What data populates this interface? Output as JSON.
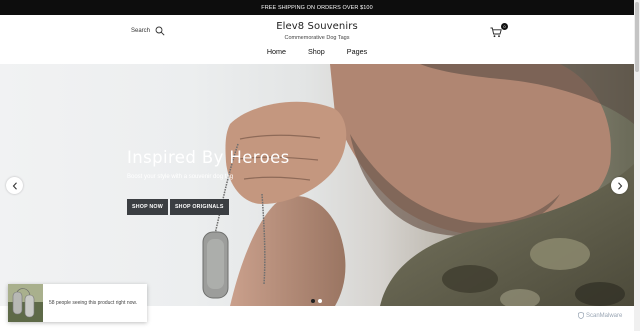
{
  "announcement": {
    "text": "FREE SHIPPING ON ORDERS OVER $100"
  },
  "header": {
    "search_label": "Search",
    "brand_name": "Elev8 Souvenirs",
    "brand_tagline": "Commemorative Dog Tags",
    "cart_count": "0",
    "nav": [
      {
        "label": "Home"
      },
      {
        "label": "Shop"
      },
      {
        "label": "Pages"
      }
    ]
  },
  "hero": {
    "title": "Inspired By Heroes",
    "subtitle": "Boost your style with a souvenir dog tag",
    "buttons": [
      {
        "label": "SHOP NOW"
      },
      {
        "label": "SHOP ORIGINALS"
      }
    ],
    "slide_count": 2,
    "active_slide": 1
  },
  "popup": {
    "message": "58 people seeing this product right now."
  },
  "watermark": {
    "text": "ScanMalware"
  },
  "colors": {
    "announcement_bg": "#0d0d0d",
    "button_bg": "#3b3e42"
  }
}
